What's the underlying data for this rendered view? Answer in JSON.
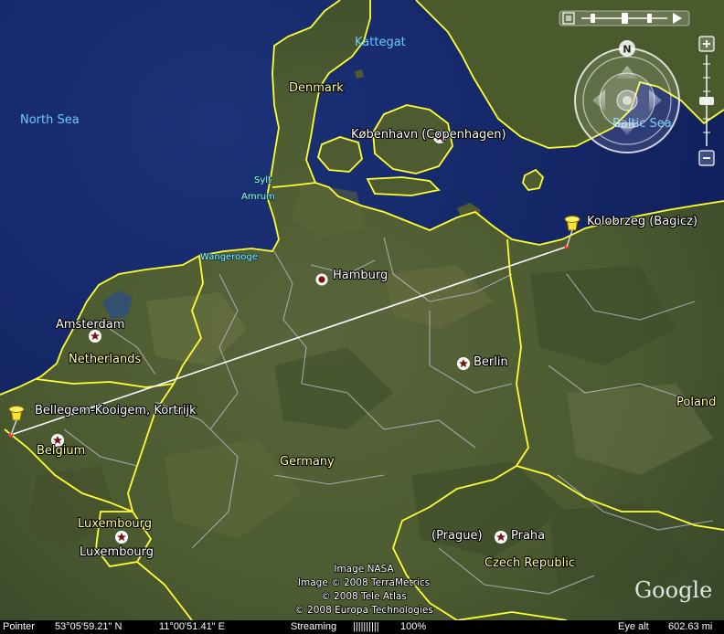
{
  "labels": {
    "seas": {
      "north_sea": "North Sea",
      "kattegat": "Kattegat",
      "baltic_sea": "Baltic Sea"
    },
    "countries": {
      "denmark": "Denmark",
      "netherlands": "Netherlands",
      "belgium": "Belgium",
      "germany": "Germany",
      "luxembourg_country": "Luxembourg",
      "poland": "Poland",
      "czech_republic": "Czech Republic"
    },
    "islands": {
      "sylt": "Sylt",
      "amrum": "Amrum",
      "wangerooge": "Wangerooge"
    },
    "places": {
      "copenhagen": "København (Copenhagen)",
      "hamburg": "Hamburg",
      "amsterdam": "Amsterdam",
      "berlin": "Berlin",
      "luxembourg_city": "Luxembourg",
      "prague_alt": "(Prague)",
      "praha": "Praha"
    },
    "placemarks": {
      "kolobrzeg": "Kolobrzeg (Bagicz)",
      "bellegem": "Bellegem-Kooigem, Kortrijk"
    }
  },
  "credits": [
    "Image NASA",
    "Image © 2008 TerraMetrics",
    "© 2008 Tele Atlas",
    "© 2008 Europa Technologies"
  ],
  "logo": "Google",
  "nav": {
    "north_label": "N"
  },
  "statusbar": {
    "pointer_label": "Pointer",
    "latitude": "53°05'59.21\" N",
    "longitude": "11°00'51.41\" E",
    "streaming_label": "Streaming",
    "streaming_bar": "||||||||||",
    "streaming_pct": "100%",
    "eye_alt_label": "Eye alt",
    "eye_alt_value": "602.63 mi"
  },
  "colors": {
    "sea": "#172a6e",
    "land": "#4d5a2e",
    "border": "#ffff33",
    "admin": "#b8b8c8",
    "path": "#ffffff",
    "pin": "#ffe033"
  }
}
